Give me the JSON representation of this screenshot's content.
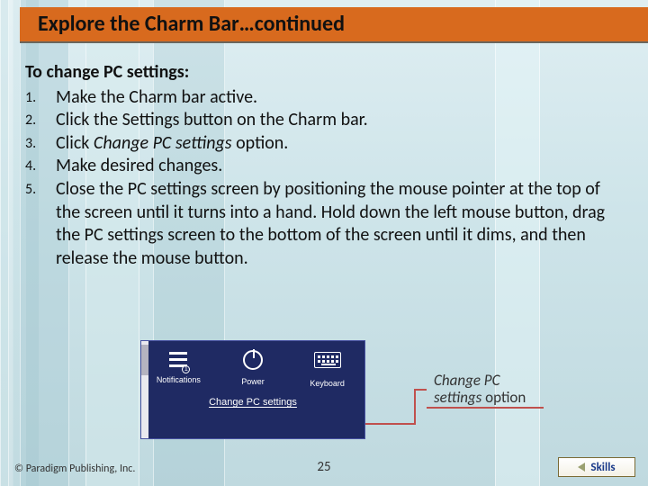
{
  "title": "Explore the Charm Bar…continued",
  "lead": "To change PC settings:",
  "steps": [
    {
      "n": "1.",
      "plain_before": "Make the Charm bar active.",
      "italic": "",
      "plain_after": ""
    },
    {
      "n": "2.",
      "plain_before": "Click the Settings button on the Charm bar.",
      "italic": "",
      "plain_after": ""
    },
    {
      "n": "3.",
      "plain_before": "Click ",
      "italic": "Change PC settings",
      "plain_after": " option."
    },
    {
      "n": "4.",
      "plain_before": "Make desired changes.",
      "italic": "",
      "plain_after": ""
    },
    {
      "n": "5.",
      "plain_before": "Close the PC settings screen by positioning the mouse pointer at the top of the screen until it turns into a hand. Hold down the left mouse button, drag the PC settings screen to the bottom of the screen until it dims, and then release the mouse button.",
      "italic": "",
      "plain_after": ""
    }
  ],
  "panel": {
    "items": [
      {
        "label": "Notifications"
      },
      {
        "label": "Power"
      },
      {
        "label": "Keyboard"
      }
    ],
    "change_link": "Change PC settings"
  },
  "callout": {
    "line1": "Change PC",
    "line2_italic": "settings",
    "line2_plain": " option"
  },
  "footer": {
    "copyright": "© Paradigm Publishing, Inc.",
    "page": "25",
    "skills": "Skills"
  }
}
